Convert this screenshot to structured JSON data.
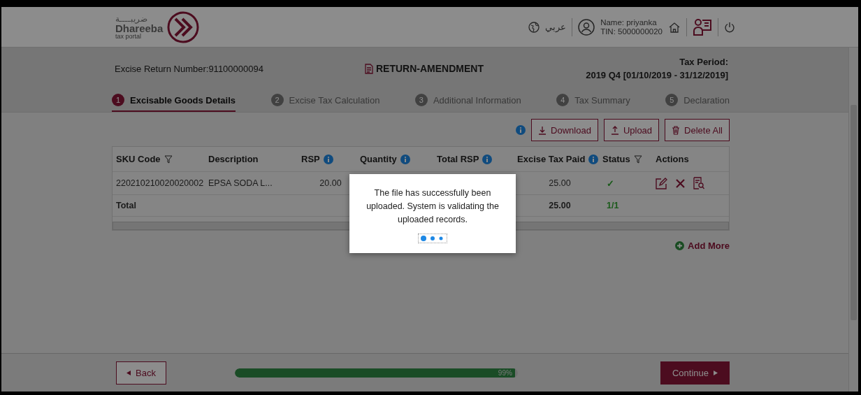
{
  "header": {
    "logo": {
      "arabic": "ضريبــــة",
      "name": "Dhareeba",
      "tagline": "tax portal"
    },
    "language": "عربي",
    "user": {
      "name": "Name: priyanka",
      "tin": "TIN: 5000000020"
    }
  },
  "return_info": {
    "number_label": "Excise Return Number:",
    "number": "91100000094",
    "type": "RETURN-AMENDMENT",
    "period_label": "Tax Period:",
    "period": "2019 Q4 [01/10/2019 - 31/12/2019]"
  },
  "steps": [
    {
      "number": "1",
      "label": "Excisable Goods Details",
      "selected": true
    },
    {
      "number": "2",
      "label": "Excise Tax Calculation",
      "selected": false
    },
    {
      "number": "3",
      "label": "Additional Information",
      "selected": false
    },
    {
      "number": "4",
      "label": "Tax Summary",
      "selected": false
    },
    {
      "number": "5",
      "label": "Declaration",
      "selected": false
    }
  ],
  "toolbar": {
    "buttons": [
      {
        "kind": "download",
        "label": "Download"
      },
      {
        "kind": "upload",
        "label": "Upload"
      },
      {
        "kind": "delete",
        "label": "Delete All"
      }
    ]
  },
  "table": {
    "columns": [
      {
        "label": "SKU Code",
        "kind": "filter"
      },
      {
        "label": "Description",
        "kind": "plain"
      },
      {
        "label": "RSP",
        "kind": "info"
      },
      {
        "label": "Quantity",
        "kind": "info"
      },
      {
        "label": "Total RSP",
        "kind": "info"
      },
      {
        "label": "Excise Tax Paid",
        "kind": "info"
      },
      {
        "label": "Status",
        "kind": "filter"
      },
      {
        "label": "Actions",
        "kind": "plain"
      }
    ],
    "rows": [
      {
        "kind": "item",
        "cells": [
          "220210210020020002",
          "EPSA SODA L...",
          "20.00",
          "",
          "",
          "25.00",
          "✓",
          ""
        ]
      },
      {
        "kind": "total",
        "cells": [
          "Total",
          "",
          "",
          "",
          "",
          "25.00",
          "1/1",
          ""
        ]
      }
    ]
  },
  "add_more": "Add More",
  "modal": {
    "message": "The file has successfully been uploaded. System is validating the uploaded records."
  },
  "footer": {
    "back": "Back",
    "progress": {
      "level": 0.99,
      "label": "99%"
    },
    "continue": "Continue"
  }
}
